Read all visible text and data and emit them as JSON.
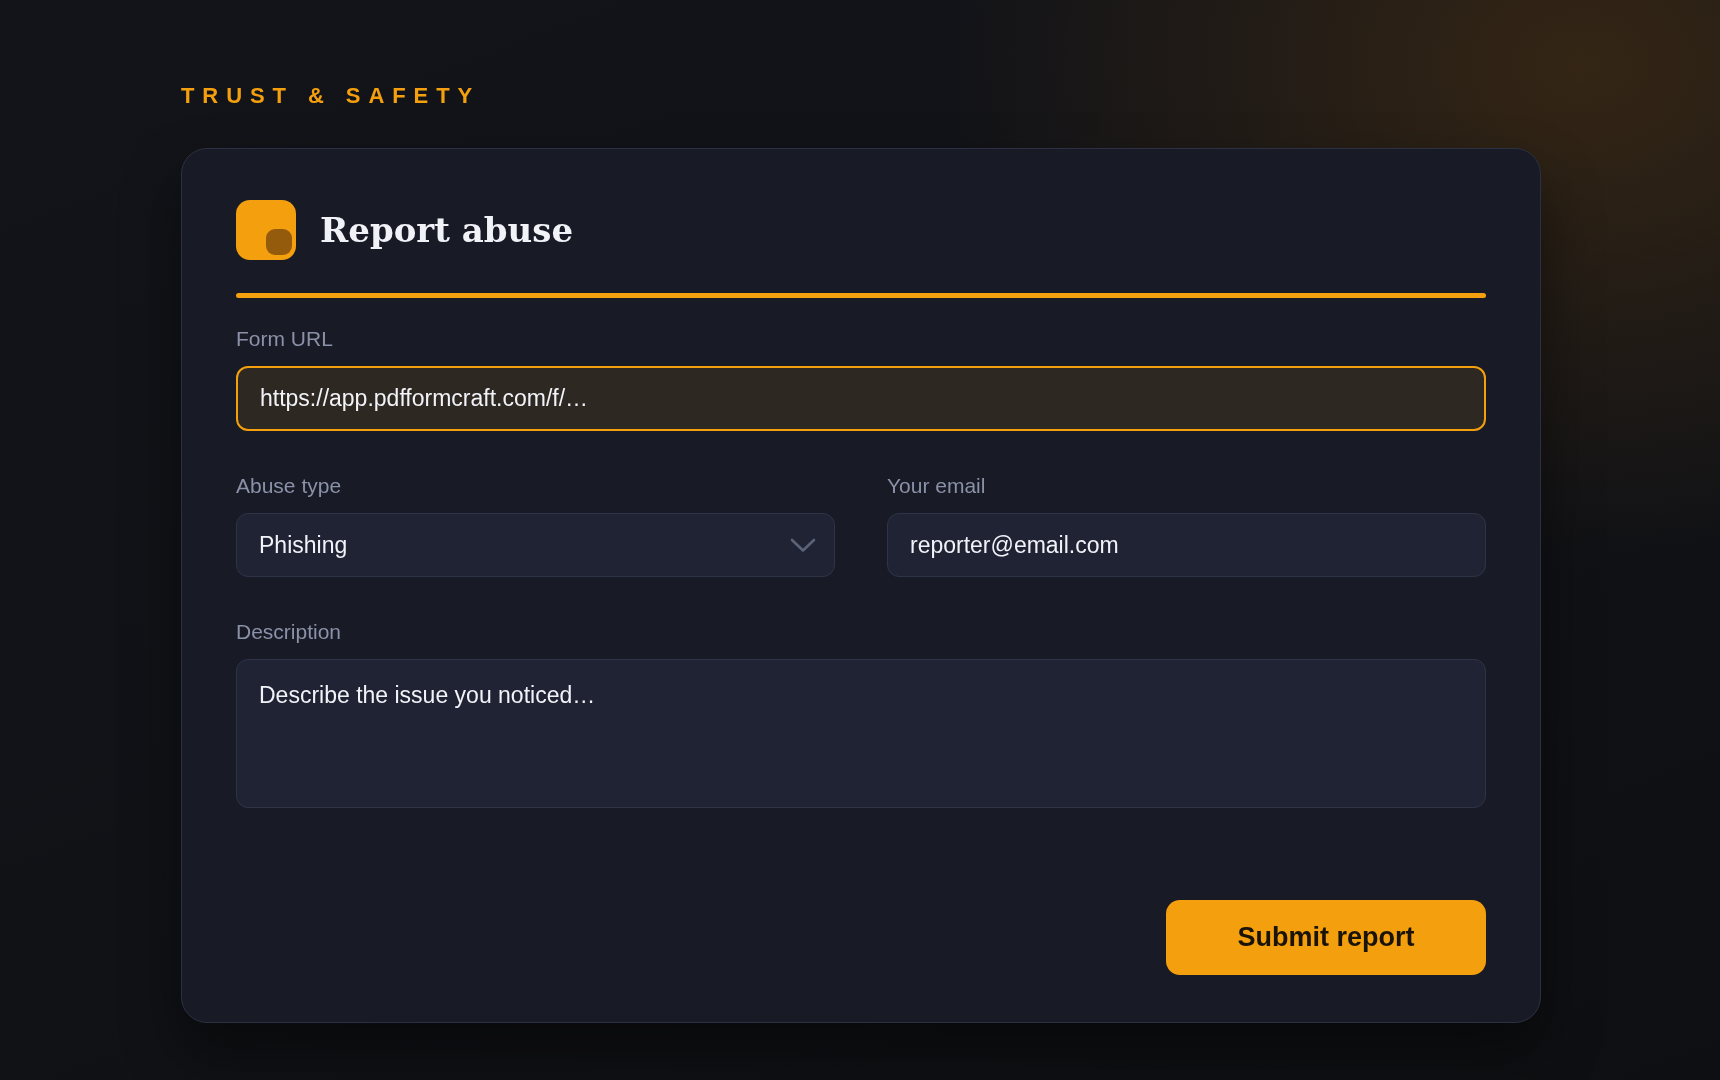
{
  "eyebrow": "TRUST & SAFETY",
  "card": {
    "title": "Report abuse"
  },
  "rows": [
    [
      {
        "kind": "text",
        "label": "Form URL",
        "placeholder": "https://app.pdfformcraft.com/f/…",
        "focused": true
      }
    ],
    [
      {
        "kind": "select",
        "label": "Abuse type",
        "value": "Phishing",
        "focused": false
      },
      {
        "kind": "text",
        "label": "Your email",
        "placeholder": "reporter@email.com",
        "focused": false
      }
    ],
    [
      {
        "kind": "textarea",
        "label": "Description",
        "placeholder": "Describe the issue you noticed…",
        "focused": false
      }
    ]
  ],
  "submit_button": "Submit report"
}
